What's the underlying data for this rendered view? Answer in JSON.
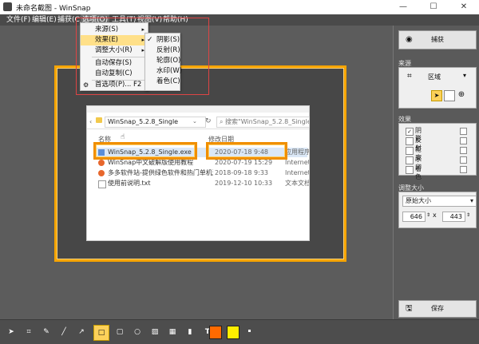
{
  "window": {
    "title": "未命名截图 - WinSnap",
    "controls": [
      "—",
      "☐",
      "✕"
    ]
  },
  "menubar": {
    "items": [
      {
        "label": "文件(F)"
      },
      {
        "label": "编辑(E)"
      },
      {
        "label": "捕获(C)"
      },
      {
        "label": "选项(O)"
      },
      {
        "label": "工具(T)"
      },
      {
        "label": "视图(V)"
      },
      {
        "label": "帮助(H)"
      }
    ]
  },
  "options_menu": {
    "items": [
      {
        "label": "来源(S)",
        "submenu": true
      },
      {
        "label": "效果(E)",
        "submenu": true,
        "selected": true
      },
      {
        "label": "调整大小(R)",
        "submenu": true
      },
      {
        "label": "自动保存(S)"
      },
      {
        "label": "自动复制(C)"
      },
      {
        "label": "首选项(P)...",
        "shortcut": "F2"
      }
    ]
  },
  "effects_submenu": {
    "items": [
      {
        "label": "阴影(S)",
        "checked": true
      },
      {
        "label": "反射(R)"
      },
      {
        "label": "轮廓(O)"
      },
      {
        "label": "水印(W)"
      },
      {
        "label": "着色(C)"
      }
    ]
  },
  "explorer": {
    "path": "WinSnap_5.2.8_Single",
    "search_placeholder": "搜索\"WinSnap_5.2.8_Single\"",
    "columns": {
      "name": "名称",
      "date": "修改日期"
    },
    "files": [
      {
        "name": "WinSnap_5.2.8_Single.exe",
        "date": "2020-07-18 9:48",
        "type": "应用程序",
        "highlight": true
      },
      {
        "name": "WinSnap中文破解版使用教程",
        "date": "2020-07-19 15:29",
        "type": "Internet"
      },
      {
        "name": "多多软件站-提供绿色软件和热门单机游...",
        "date": "2018-09-18 9:33",
        "type": "Internet"
      },
      {
        "name": "使用前说明.txt",
        "date": "2019-12-10 10:33",
        "type": "文本文档"
      }
    ]
  },
  "panel": {
    "capture_label": "捕获",
    "source_title": "来源",
    "source_value": "区域",
    "effects_title": "效果",
    "effects": [
      {
        "label": "阴影",
        "checked": true
      },
      {
        "label": "反射",
        "checked": false
      },
      {
        "label": "轮廓",
        "checked": false
      },
      {
        "label": "水印",
        "checked": false
      },
      {
        "label": "着色",
        "checked": false
      }
    ],
    "resize_title": "调整大小",
    "resize_mode": "原始大小",
    "width": "646",
    "times": "x",
    "height": "443",
    "save_label": "保存",
    "copy_label": "复制"
  },
  "colors": {
    "accent": "#f6a400",
    "swatch_primary": "#ff6a00",
    "swatch_secondary": "#ffee00"
  },
  "tools": [
    {
      "name": "select-tool-icon",
      "glyph": "➤"
    },
    {
      "name": "crop-tool-icon",
      "glyph": "⌗"
    },
    {
      "name": "pen-tool-icon",
      "glyph": "✎"
    },
    {
      "name": "line-tool-icon",
      "glyph": "╱"
    },
    {
      "name": "arrow-tool-icon",
      "glyph": "↗"
    },
    {
      "name": "rectangle-tool-icon",
      "glyph": "□",
      "active": true
    },
    {
      "name": "rounded-rect-tool-icon",
      "glyph": "▢"
    },
    {
      "name": "ellipse-tool-icon",
      "glyph": "○"
    },
    {
      "name": "hatch-tool-icon",
      "glyph": "▨"
    },
    {
      "name": "pixelate-tool-icon",
      "glyph": "▦"
    },
    {
      "name": "highlight-tool-icon",
      "glyph": "▮"
    },
    {
      "name": "text-tool-icon",
      "glyph": "T"
    }
  ]
}
